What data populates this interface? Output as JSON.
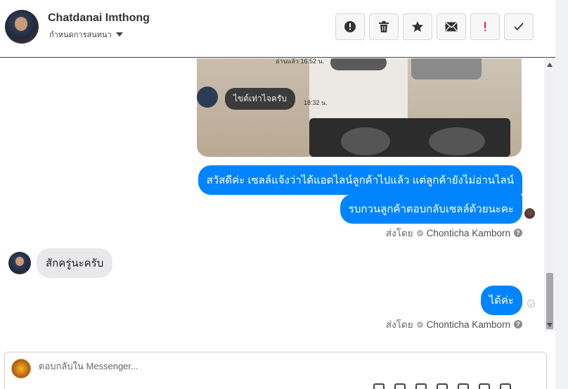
{
  "header": {
    "contact_name": "Chatdanai Imthong",
    "label_text": "กำหนดการสนทนา",
    "actions": [
      {
        "name": "spam-report-icon",
        "glyph": "!"
      },
      {
        "name": "delete-icon",
        "glyph": "trash"
      },
      {
        "name": "star-icon",
        "glyph": "star"
      },
      {
        "name": "mark-unread-icon",
        "glyph": "envelope"
      },
      {
        "name": "follow-up-icon",
        "glyph": "!"
      },
      {
        "name": "mark-done-icon",
        "glyph": "check"
      }
    ]
  },
  "image_message": {
    "bubble_text": "ไขต์เท่าไจครับ",
    "time": "18:32 น.",
    "read_text": "อ่านแล้ว 16.52 น."
  },
  "messages": {
    "outgoing_1": "สวัสดีค่ะ เซลล์แจ้งว่าได้แอดไลน์ลูกค้าไปแล้ว แต่ลูกค้ายังไม่อ่านไลน์",
    "outgoing_2": "รบกวนลูกค้าตอบกลับเซลล์ด้วยนะคะ",
    "incoming_1": "สักครู่นะครับ",
    "outgoing_3": "ได้ค่ะ"
  },
  "sent_by": {
    "prefix": "ส่งโดย",
    "agent_1": "Chonticha Kamborn",
    "agent_2": "Chonticha Kamborn",
    "help_glyph": "?"
  },
  "composer": {
    "placeholder": "ตอบกลับใน Messenger..."
  },
  "colors": {
    "outgoing_bubble": "#0084ff",
    "incoming_bubble": "#e9e9eb",
    "follow_up_red": "#e41e3f"
  }
}
